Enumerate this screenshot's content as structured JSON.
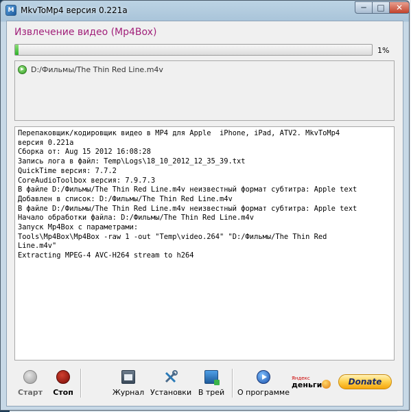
{
  "window": {
    "title": "MkvToMp4 версия 0.221a",
    "min_glyph": "─",
    "max_glyph": "□",
    "close_glyph": "✕"
  },
  "operation_title": "Извлечение видео (Mp4Box)",
  "progress": {
    "fraction": 0.01,
    "label": "1%"
  },
  "file_list": [
    {
      "name": "D:/Фильмы/The Thin Red Line.m4v",
      "icon": "play-circle-icon"
    }
  ],
  "log_lines": [
    "Перепаковщик/кодировщик видео в MP4 для Apple  iPhone, iPad, ATV2. MkvToMp4",
    "версия 0.221a",
    "Сборка от: Aug 15 2012 16:08:28",
    "Запись лога в файл: Temp\\Logs\\18_10_2012_12_35_39.txt",
    "QuickTime версия: 7.7.2",
    "CoreAudioToolbox версия: 7.9.7.3",
    "В файле D:/Фильмы/The Thin Red Line.m4v неизвестный формат субтитра: Apple text",
    "Добавлен в список: D:/Фильмы/The Thin Red Line.m4v",
    "В файле D:/Фильмы/The Thin Red Line.m4v неизвестный формат субтитра: Apple text",
    "Начало обработки файла: D:/Фильмы/The Thin Red Line.m4v",
    "Запуск Mp4Box с параметрами:",
    "Tools\\Mp4Box\\Mp4Box -raw 1 -out \"Temp\\video.264\" \"D:/Фильмы/The Thin Red",
    "Line.m4v\"",
    "Extracting MPEG-4 AVC-H264 stream to h264"
  ],
  "toolbar": {
    "start": "Старт",
    "stop": "Стоп",
    "journal": "Журнал",
    "settings": "Установки",
    "tray": "В трей",
    "about": "О программе",
    "yandex_small": "Яндекс",
    "yandex_big": "деньги",
    "donate": "Donate"
  },
  "colors": {
    "title_accent": "#a1207a",
    "progress_fill": "#2fb22a",
    "stop_red": "#7a0c06"
  }
}
